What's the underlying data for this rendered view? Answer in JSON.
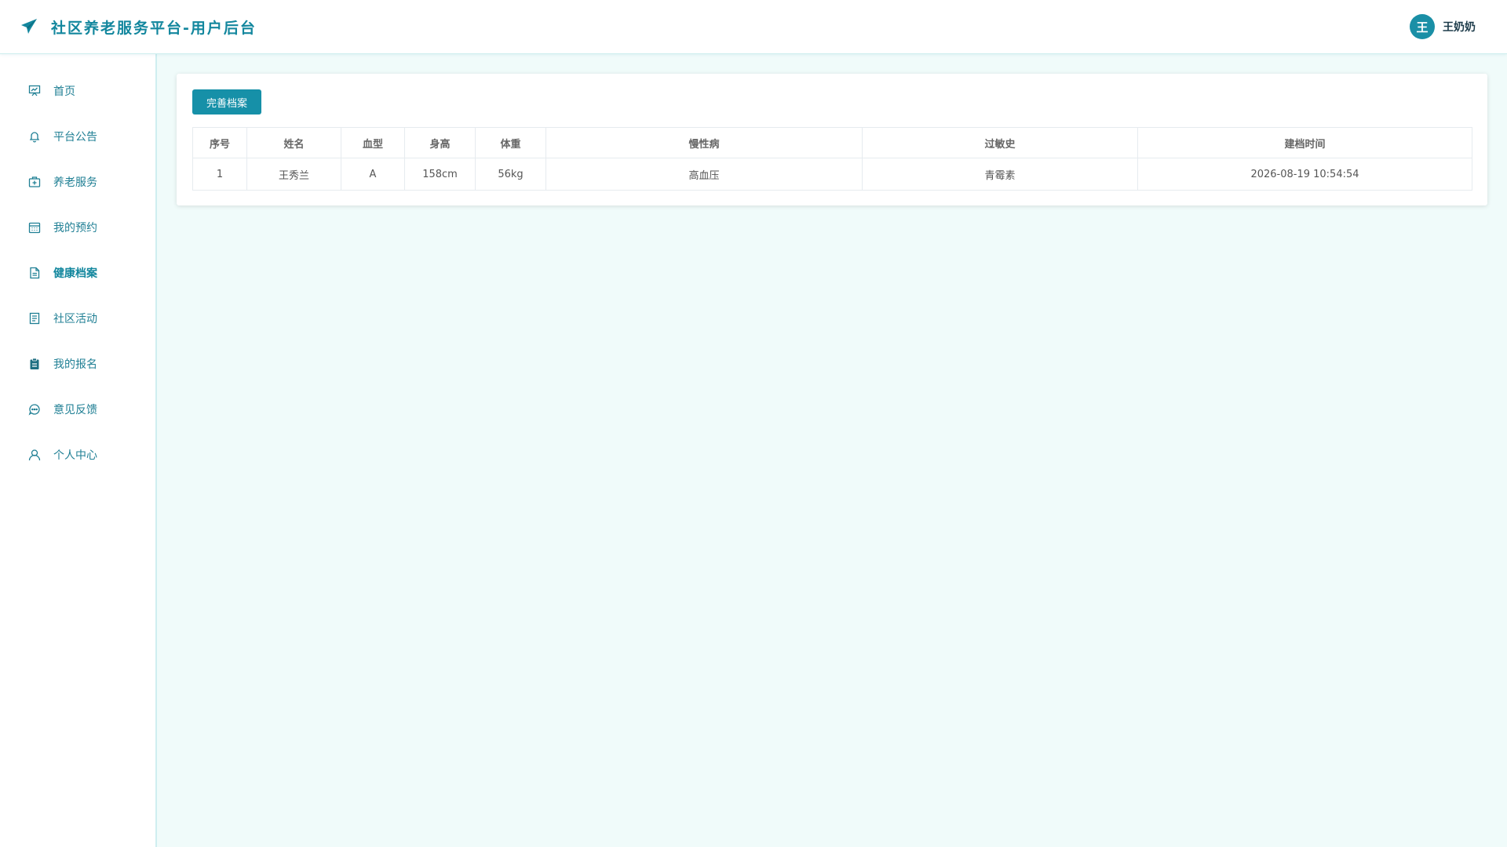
{
  "header": {
    "title": "社区养老服务平台-用户后台",
    "logo_icon": "paper-plane-icon",
    "user": {
      "avatar_text": "王",
      "name": "王奶奶"
    }
  },
  "colors": {
    "accent": "#13879e",
    "button": "#1690a8",
    "background": "#f0fbfa"
  },
  "sidebar": {
    "items": [
      {
        "label": "首页",
        "icon": "presentation-board-icon"
      },
      {
        "label": "平台公告",
        "icon": "bell-icon"
      },
      {
        "label": "养老服务",
        "icon": "medical-kit-icon"
      },
      {
        "label": "我的预约",
        "icon": "calendar-icon"
      },
      {
        "label": "健康档案",
        "icon": "document-icon",
        "active": true
      },
      {
        "label": "社区活动",
        "icon": "list-doc-icon"
      },
      {
        "label": "我的报名",
        "icon": "clipboard-icon"
      },
      {
        "label": "意见反馈",
        "icon": "chat-bubble-icon"
      },
      {
        "label": "个人中心",
        "icon": "user-icon"
      }
    ]
  },
  "main": {
    "action_button": "完善档案",
    "table": {
      "headers": [
        "序号",
        "姓名",
        "血型",
        "身高",
        "体重",
        "慢性病",
        "过敏史",
        "建档时间"
      ],
      "rows": [
        [
          "1",
          "王秀兰",
          "A",
          "158cm",
          "56kg",
          "高血压",
          "青霉素",
          "2026-08-19 10:54:54"
        ]
      ]
    }
  }
}
